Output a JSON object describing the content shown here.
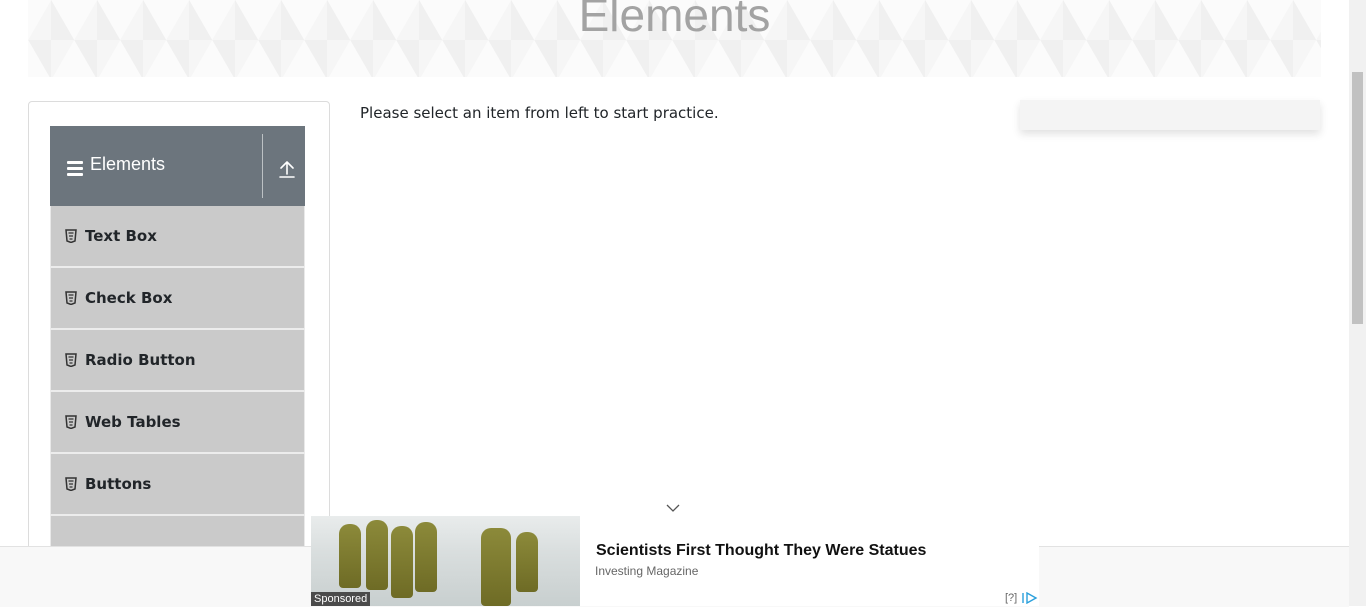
{
  "header": {
    "title": "Elements"
  },
  "sidebar": {
    "group": {
      "label": "Elements",
      "icon": "hamburger-icon",
      "collapse_icon": "collapse-up-icon"
    },
    "items": [
      {
        "label": "Text Box",
        "icon": "html5-icon"
      },
      {
        "label": "Check Box",
        "icon": "html5-icon"
      },
      {
        "label": "Radio Button",
        "icon": "html5-icon"
      },
      {
        "label": "Web Tables",
        "icon": "html5-icon"
      },
      {
        "label": "Buttons",
        "icon": "html5-icon"
      }
    ]
  },
  "main": {
    "message": "Please select an item from left to start practice."
  },
  "ad": {
    "headline": "Scientists First Thought They Were Statues",
    "source": "Investing Magazine",
    "sponsored_label": "Sponsored",
    "help_label": "[?]"
  },
  "colors": {
    "header_bg": "#6c757d",
    "menu_item_bg": "#cacaca",
    "title_gray": "#a3a3a3"
  }
}
